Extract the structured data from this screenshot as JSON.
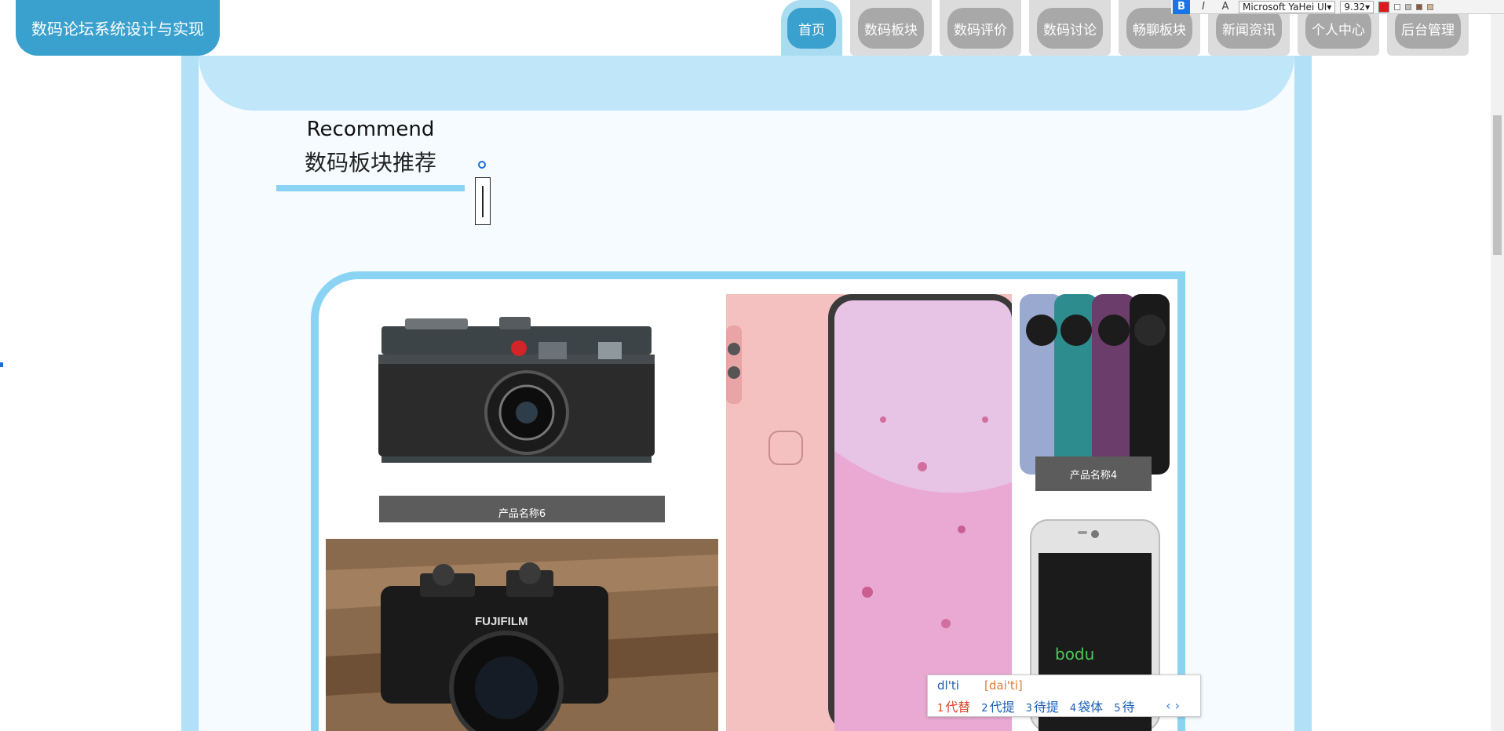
{
  "header": {
    "logo": "数码论坛系统设计与实现",
    "nav": [
      "首页",
      "数码板块",
      "数码评价",
      "数码讨论",
      "畅聊板块",
      "新闻资讯",
      "个人中心",
      "后台管理"
    ],
    "active_index": 0
  },
  "section": {
    "title_en": "Recommend",
    "title_cn": "数码板块推荐"
  },
  "products": {
    "card_a_caption": "产品名称6",
    "card_b_caption": "产品名称4",
    "phone_brand": "bodu"
  },
  "toolbar": {
    "bold": "B",
    "italic": "I",
    "clear": "A",
    "font": "Microsoft YaHei UI",
    "size": "9.32"
  },
  "ime": {
    "typed": "dl'ti",
    "pinyin": "[dai'ti]",
    "candidates": [
      {
        "n": "1",
        "text": "代替"
      },
      {
        "n": "2",
        "text": "代提"
      },
      {
        "n": "3",
        "text": "待提"
      },
      {
        "n": "4",
        "text": "袋体"
      },
      {
        "n": "5",
        "text": "待"
      }
    ],
    "pager": "‹ ›"
  },
  "colors": {
    "accent": "#3aa1ce",
    "frame": "#b2e0f6",
    "nav_inactive": "#a8a8a8"
  }
}
